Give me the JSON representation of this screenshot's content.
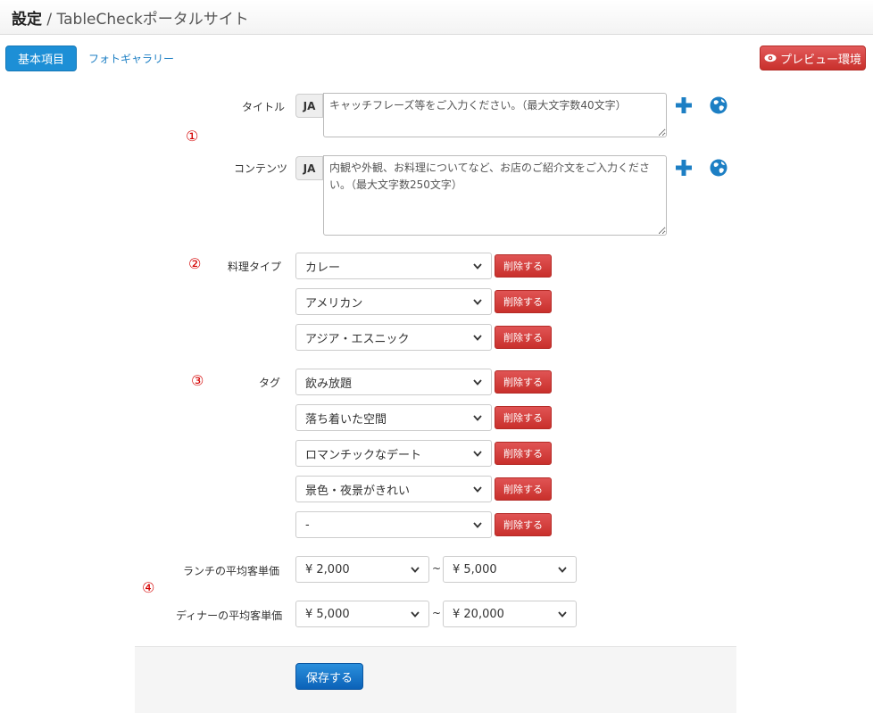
{
  "header": {
    "section": "設定",
    "separator": " / ",
    "page": "TableCheckポータルサイト"
  },
  "tabs": {
    "basic": "基本項目",
    "gallery": "フォトギャラリー"
  },
  "preview": {
    "label": "プレビュー環境"
  },
  "markers": {
    "m1": "①",
    "m2": "②",
    "m3": "③",
    "m4": "④"
  },
  "title_field": {
    "label": "タイトル",
    "lang": "JA",
    "placeholder": "キャッチフレーズ等をご入力ください。（最大文字数40文字）"
  },
  "content_field": {
    "label": "コンテンツ",
    "lang": "JA",
    "placeholder": "内観や外観、お料理についてなど、お店のご紹介文をご入力ください。（最大文字数250文字）"
  },
  "cuisine": {
    "label": "料理タイプ",
    "items": [
      "カレー",
      "アメリカン",
      "アジア・エスニック"
    ]
  },
  "tags": {
    "label": "タグ",
    "items": [
      "飲み放題",
      "落ち着いた空間",
      "ロマンチックなデート",
      "景色・夜景がきれい",
      "-"
    ]
  },
  "delete_label": "削除する",
  "lunch": {
    "label": "ランチの平均客単価",
    "min": "¥ 2,000",
    "max": "¥ 5,000"
  },
  "dinner": {
    "label": "ディナーの平均客単価",
    "min": "¥ 5,000",
    "max": "¥ 20,000"
  },
  "range_sep": "~",
  "save": {
    "label": "保存する"
  },
  "colors": {
    "primary": "#1d8fd6",
    "danger": "#c9302c",
    "marker": "#d40000"
  }
}
